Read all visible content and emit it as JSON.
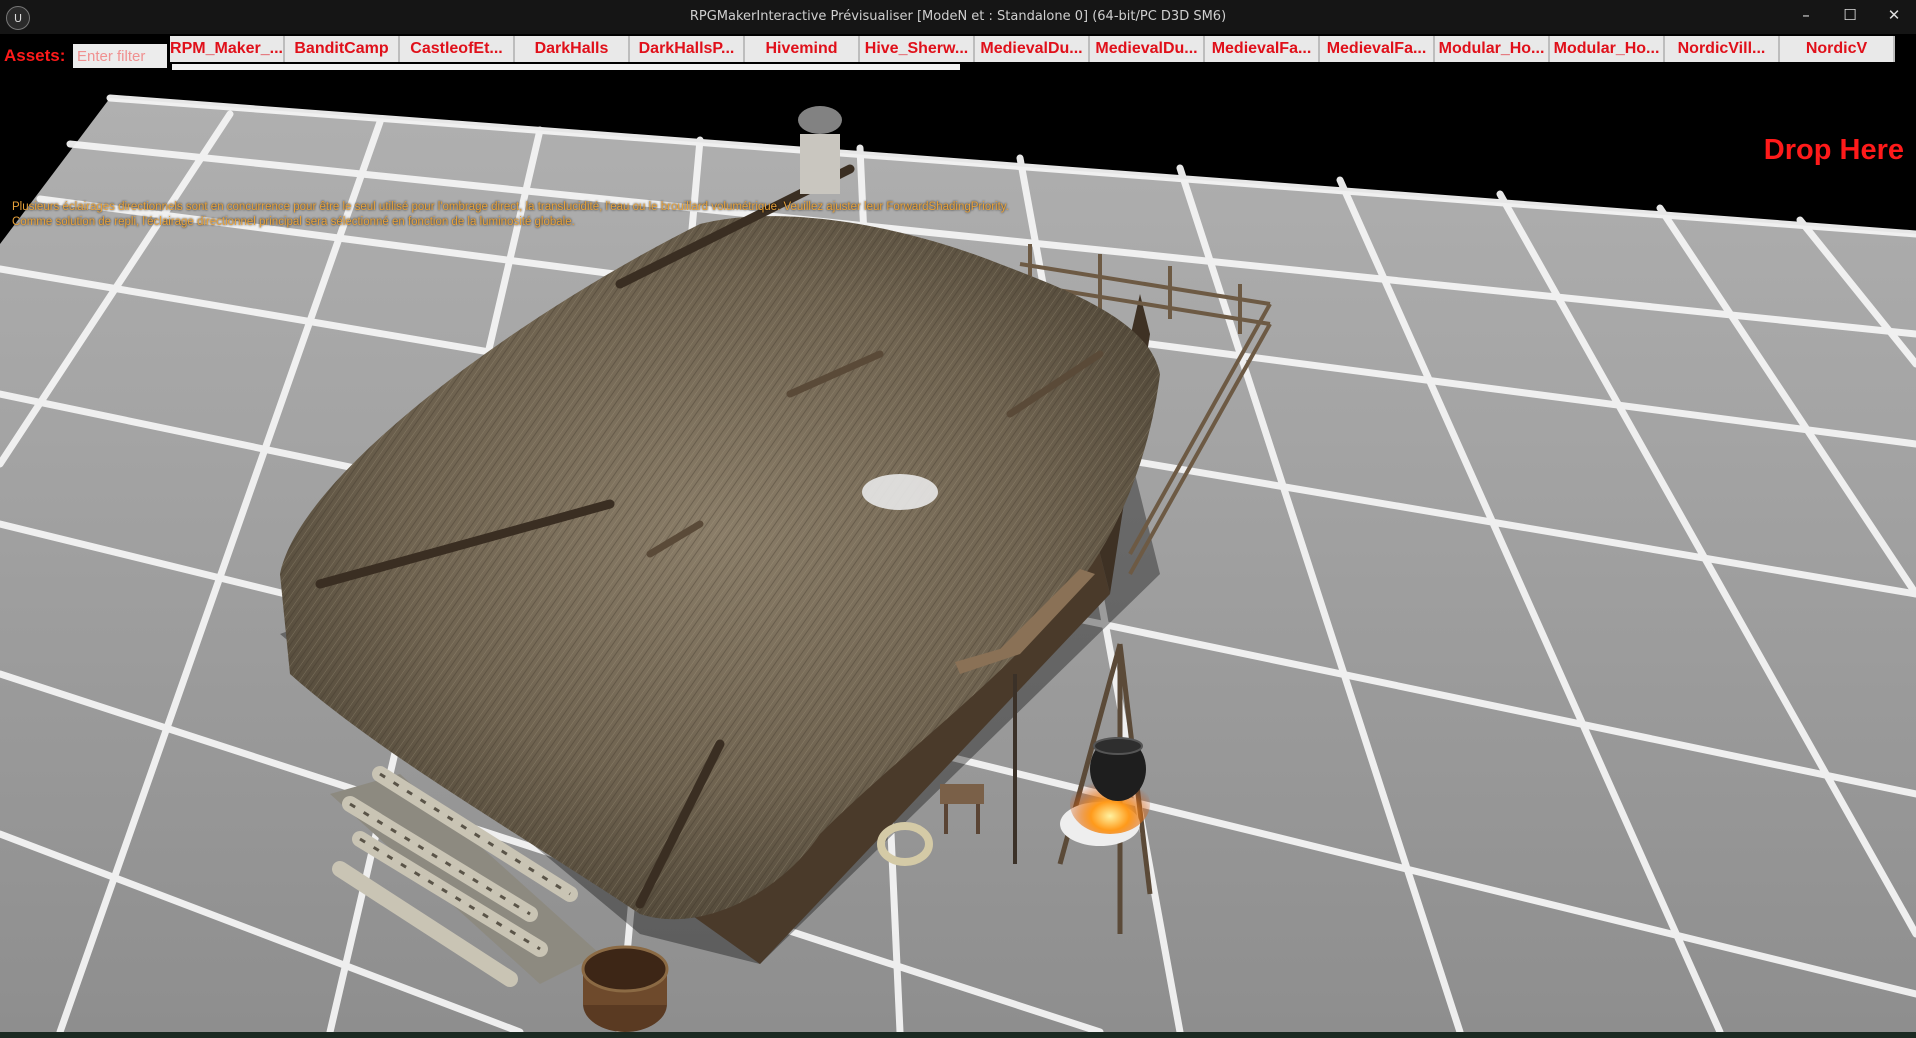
{
  "window": {
    "title": "RPGMakerInteractive Prévisualiser [ModeN et : Standalone 0]  (64-bit/PC D3D SM6)",
    "icon": "unreal-engine-icon",
    "controls": {
      "minimize": "–",
      "maximize": "☐",
      "close": "✕"
    }
  },
  "assets": {
    "label": "Assets:",
    "filter_placeholder": "Enter filter",
    "tabs": [
      "RPM_Maker_...",
      "BanditCamp",
      "CastleofEt...",
      "DarkHalls",
      "DarkHallsP...",
      "Hivemind",
      "Hive_Sherw...",
      "MedievalDu...",
      "MedievalDu...",
      "MedievalFa...",
      "MedievalFa...",
      "Modular_Ho...",
      "Modular_Ho...",
      "NordicVill...",
      "NordicV"
    ]
  },
  "viewport": {
    "drop_label": "Drop Here",
    "warning_lines": [
      "Plusieurs éclairages directionnels sont en concurrence pour être le seul utilisé pour l'ombrage direct, la translucidité, l'eau ou le brouillard volumétrique. Veuillez ajuster leur ForwardShadingPriority.",
      "Comme solution de repli, l'éclairage directionnel principal sera sélectionné en fonction de la luminosité globale."
    ]
  },
  "colors": {
    "accent_red": "#ff1a1a",
    "warning_orange": "#e8a23a",
    "floor_grey": "#9a9a9a",
    "grid_white": "#f4f4f4"
  }
}
